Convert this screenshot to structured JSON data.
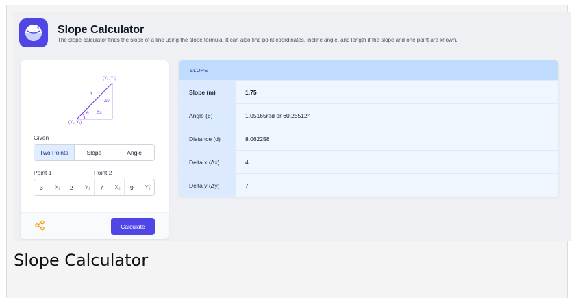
{
  "app": {
    "title": "Slope Calculator",
    "subtitle": "The slope calculator finds the slope of a line using the slope formula. It can also find point coordinates, incline angle, and length if the slope and one point are known.",
    "icon_text": "3D"
  },
  "diagram": {
    "label_p2": "(X₂, Y₂)",
    "label_p1": "(X₁, Y₁)",
    "label_d": "d",
    "label_dy": "Δy",
    "label_dx": "Δx",
    "label_theta": "θ"
  },
  "form": {
    "given_label": "Given",
    "modes": [
      "Two Points",
      "Slope",
      "Angle"
    ],
    "active_mode": "Two Points",
    "point1_label": "Point 1",
    "point2_label": "Point 2",
    "x1_value": "3",
    "x1_suffix": "X₁",
    "y1_value": "2",
    "y1_suffix": "Y₁",
    "x2_value": "7",
    "x2_suffix": "X₂",
    "y2_value": "9",
    "y2_suffix": "Y₂",
    "calculate_label": "Calculate"
  },
  "results": {
    "header": "SLOPE",
    "rows": [
      {
        "key": "Slope (m)",
        "value": "1.75"
      },
      {
        "key": "Angle (θ)",
        "value": "1.05165rad or 60.25512°"
      },
      {
        "key": "Distance (d)",
        "value": "8.062258"
      },
      {
        "key": "Delta x (Δx)",
        "value": "4"
      },
      {
        "key": "Delta y (Δy)",
        "value": "7"
      }
    ]
  },
  "caption": "Slope Calculator",
  "colors": {
    "accent": "#4f46e5",
    "result_header": "#bfdbfe",
    "share_icon": "#f59e0b"
  }
}
